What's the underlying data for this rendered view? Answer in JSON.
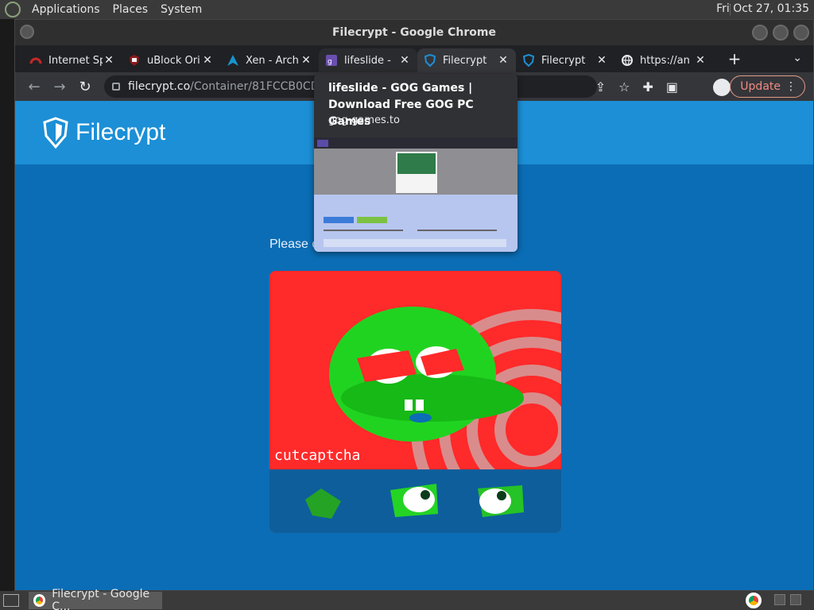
{
  "top_panel": {
    "menus": [
      "Applications",
      "Places",
      "System"
    ],
    "clock": "Fri Oct 27, 01:35"
  },
  "window": {
    "title": "Filecrypt - Google Chrome"
  },
  "tabs": [
    {
      "label": "Internet Sp",
      "favicon": "speedtest-icon",
      "color": "#c62828"
    },
    {
      "label": "uBlock Ori",
      "favicon": "ublock-icon",
      "color": "#8b1a1a"
    },
    {
      "label": "Xen - Arch",
      "favicon": "arch-icon",
      "color": "#1793d1"
    },
    {
      "label": "lifeslide - ",
      "favicon": "gog-icon",
      "color": "#6a4fb0"
    },
    {
      "label": "Filecrypt",
      "favicon": "filecrypt-shield-icon",
      "color": "#1c8fd6"
    },
    {
      "label": "Filecrypt",
      "favicon": "filecrypt-shield-icon",
      "color": "#1c8fd6"
    },
    {
      "label": "https://an",
      "favicon": "globe-icon",
      "color": "#e8eaed"
    }
  ],
  "toolbar": {
    "url_host": "filecrypt.co",
    "url_path": "/Container/81FCCB0CDB.h",
    "update_label": "Update"
  },
  "hover_card": {
    "title": "lifeslide - GOG Games | Download Free GOG PC Games",
    "url": "gog-games.to"
  },
  "page": {
    "site_name": "Filecrypt",
    "instruction": "Please c                                        ntinue.",
    "captcha_brand": "cutcaptcha"
  },
  "taskbar": {
    "item_label": "Filecrypt - Google C..."
  },
  "colors": {
    "page_bg": "#0b6db5",
    "header_bg": "#1c8fd6",
    "update_text": "#f28b82"
  }
}
